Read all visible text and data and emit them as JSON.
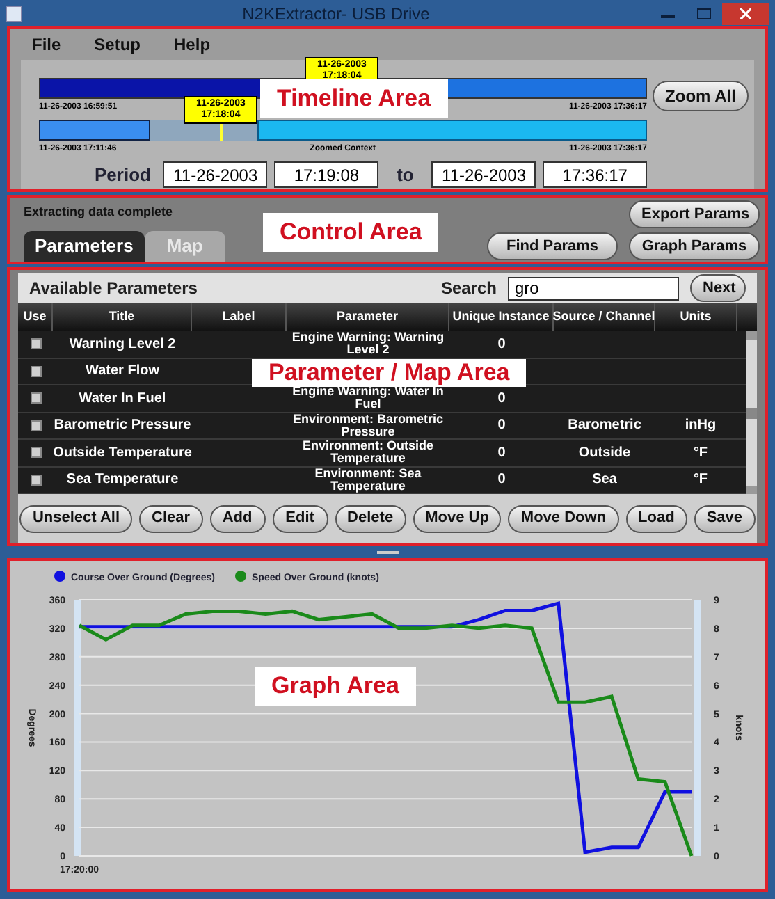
{
  "window": {
    "title": "N2KExtractor- USB Drive"
  },
  "menu": [
    "File",
    "Setup",
    "Help"
  ],
  "timeline": {
    "annotation": "Timeline Area",
    "overview": {
      "start": "11-26-2003 16:59:51",
      "end": "11-26-2003 17:36:17",
      "marker_date": "11-26-2003",
      "marker_time": "17:18:04"
    },
    "zoomed": {
      "start": "11-26-2003 17:11:46",
      "label": "Zoomed Context",
      "end": "11-26-2003 17:36:17",
      "marker_date": "11-26-2003",
      "marker_time": "17:18:04"
    },
    "zoom_button": "Zoom All",
    "period": {
      "label": "Period",
      "start_date": "11-26-2003",
      "start_time": "17:19:08",
      "to": "to",
      "end_date": "11-26-2003",
      "end_time": "17:36:17"
    }
  },
  "control": {
    "annotation": "Control Area",
    "status": "Extracting data complete",
    "tabs": [
      {
        "label": "Parameters",
        "selected": true
      },
      {
        "label": "Map",
        "selected": false
      }
    ],
    "buttons": [
      "Export Params",
      "Find Params",
      "Graph Params"
    ]
  },
  "parameters": {
    "annotation": "Parameter / Map Area",
    "title": "Available Parameters",
    "search_label": "Search",
    "search_value": "gro",
    "next_button": "Next",
    "columns": [
      "Use",
      "Title",
      "Label",
      "Parameter",
      "Unique Instance",
      "Source / Channel",
      "Units"
    ],
    "rows": [
      {
        "checked": false,
        "title": "Warning Level 2",
        "parameter": "Engine Warning: Warning Level 2",
        "instance": "0"
      },
      {
        "checked": false,
        "title": "Water Flow"
      },
      {
        "checked": false,
        "title": "Water In Fuel",
        "parameter": "Engine Warning: Water In Fuel",
        "instance": "0"
      },
      {
        "checked": false,
        "title": "Barometric Pressure",
        "parameter": "Environment: Barometric Pressure",
        "instance": "0",
        "source": "Barometric",
        "units": "inHg"
      },
      {
        "checked": false,
        "title": "Outside Temperature",
        "parameter": "Environment: Outside Temperature",
        "instance": "0",
        "source": "Outside",
        "units": "°F"
      },
      {
        "checked": false,
        "title": "Sea Temperature",
        "parameter": "Environment: Sea Temperature",
        "instance": "0",
        "source": "Sea",
        "units": "°F"
      }
    ],
    "buttons": [
      "Unselect All",
      "Clear",
      "Add",
      "Edit",
      "Delete",
      "Move Up",
      "Move Down",
      "Load",
      "Save"
    ]
  },
  "graph": {
    "annotation": "Graph Area",
    "start_time": "17:20:00",
    "chart_data": {
      "type": "line",
      "grid": true,
      "legend": "top",
      "ylabel": "Degrees",
      "y2label": "knots",
      "ylim": [
        0,
        360
      ],
      "y2lim": [
        0,
        9
      ],
      "yticks": [
        0,
        40,
        80,
        120,
        160,
        200,
        240,
        280,
        320,
        360
      ],
      "y2ticks": [
        0,
        1,
        2,
        3,
        4,
        5,
        6,
        7,
        8,
        9
      ],
      "series": [
        {
          "name": "Course Over Ground (Degrees)",
          "color": "#1010e0",
          "axis": "y",
          "values": [
            322,
            322,
            322,
            322,
            322,
            322,
            322,
            322,
            322,
            322,
            322,
            322,
            322,
            322,
            322,
            332,
            345,
            345,
            355,
            5,
            12,
            12,
            90,
            90
          ]
        },
        {
          "name": "Speed Over Ground (knots)",
          "color": "#1a8a1a",
          "axis": "y2",
          "values": [
            8.1,
            7.6,
            8.1,
            8.1,
            8.5,
            8.6,
            8.6,
            8.5,
            8.6,
            8.3,
            8.4,
            8.5,
            8.0,
            8.0,
            8.1,
            8.0,
            8.1,
            8.0,
            5.4,
            5.4,
            5.6,
            2.7,
            2.6,
            0
          ]
        }
      ]
    }
  }
}
